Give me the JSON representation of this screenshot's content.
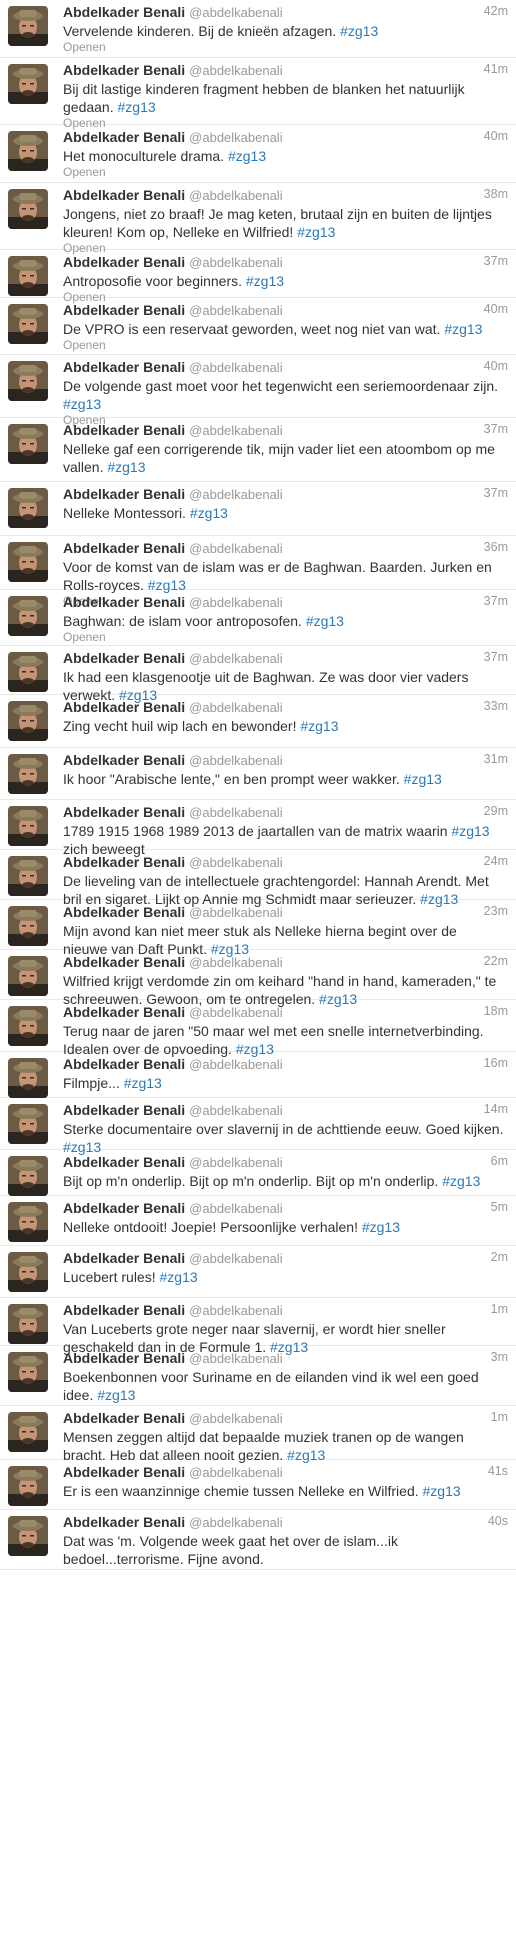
{
  "user": {
    "name": "Abdelkader Benali",
    "handle": "@abdelkabenali"
  },
  "expand_label": "Openen",
  "tweets": [
    {
      "time": "42m",
      "text": "Vervelende kinderen. Bij de knieën afzagen.",
      "tag": "#zg13",
      "open": true
    },
    {
      "time": "41m",
      "text": "Bij dit lastige kinderen fragment hebben de blanken het natuurlijk gedaan.",
      "tag": "#zg13",
      "open": true
    },
    {
      "time": "40m",
      "text": "Het monoculturele drama.",
      "tag": "#zg13",
      "open": true
    },
    {
      "time": "38m",
      "text": "Jongens, niet zo braaf! Je mag keten, brutaal zijn en buiten de lijntjes kleuren! Kom op, Nelleke en Wilfried!",
      "tag": "#zg13",
      "open": true
    },
    {
      "time": "37m",
      "text": "Antroposofie voor beginners.",
      "tag": "#zg13",
      "open": true
    },
    {
      "time": "40m",
      "text": "De VPRO is een reservaat geworden, weet nog niet van wat.",
      "tag": "#zg13",
      "open": true
    },
    {
      "time": "40m",
      "text": "De volgende gast moet voor het tegenwicht een seriemoordenaar zijn.",
      "tag": "#zg13",
      "open": true
    },
    {
      "time": "37m",
      "text": "Nelleke gaf een corrigerende tik, mijn vader liet een atoombom op me vallen.",
      "tag": "#zg13",
      "open": false
    },
    {
      "time": "37m",
      "text": "Nelleke Montessori.",
      "tag": "#zg13",
      "open": false
    },
    {
      "time": "36m",
      "text": "Voor de komst van de islam was er de Baghwan. Baarden. Jurken en Rolls-royces.",
      "tag": "#zg13",
      "open": true
    },
    {
      "time": "37m",
      "text": "Baghwan: de islam voor antroposofen.",
      "tag": "#zg13",
      "open": true
    },
    {
      "time": "37m",
      "text": "Ik had een klasgenootje uit de Baghwan. Ze was door vier vaders verwekt.",
      "tag": "#zg13",
      "open": false
    },
    {
      "time": "33m",
      "text": "Zing vecht huil wip lach en bewonder!",
      "tag": "#zg13",
      "open": false
    },
    {
      "time": "31m",
      "text": "Ik hoor \"Arabische lente,\" en ben prompt weer wakker.",
      "tag": "#zg13",
      "open": false
    },
    {
      "time": "29m",
      "text": "1789 1915 1968 1989 2013 de jaartallen van de matrix waarin",
      "tag": "#zg13",
      "tail": " zich beweegt",
      "open": false
    },
    {
      "time": "24m",
      "text": "De lieveling van de intellectuele grachtengordel: Hannah Arendt. Met bril en sigaret. Lijkt op Annie mg Schmidt maar serieuzer.",
      "tag": "#zg13",
      "open": false
    },
    {
      "time": "23m",
      "text": "Mijn avond kan niet meer stuk als Nelleke hierna begint over de nieuwe van Daft Punkt.",
      "tag": "#zg13",
      "open": false
    },
    {
      "time": "22m",
      "text": "Wilfried krijgt verdomde zin om keihard \"hand in hand, kameraden,\" te schreeuwen. Gewoon, om te ontregelen.",
      "tag": "#zg13",
      "open": false
    },
    {
      "time": "18m",
      "text": "Terug naar de jaren \"50 maar wel met een snelle internetverbinding. Idealen over de opvoeding.",
      "tag": "#zg13",
      "open": false
    },
    {
      "time": "16m",
      "text": "Filmpje...",
      "tag": "#zg13",
      "open": false
    },
    {
      "time": "14m",
      "text": "Sterke documentaire over slavernij in de achttiende eeuw. Goed kijken.",
      "tag": "#zg13",
      "open": false
    },
    {
      "time": "6m",
      "text": "Bijt op m'n onderlip. Bijt op m'n onderlip. Bijt op m'n onderlip.",
      "tag": "#zg13",
      "open": false
    },
    {
      "time": "5m",
      "text": "Nelleke ontdooit! Joepie! Persoonlijke verhalen!",
      "tag": "#zg13",
      "open": false
    },
    {
      "time": "2m",
      "text": "Lucebert rules!",
      "tag": "#zg13",
      "open": false
    },
    {
      "time": "1m",
      "text": "Van Luceberts grote neger naar slavernij, er wordt hier sneller geschakeld dan in de Formule 1.",
      "tag": "#zg13",
      "open": false
    },
    {
      "time": "3m",
      "text": "Boekenbonnen voor Suriname en de eilanden vind ik wel een goed idee.",
      "tag": "#zg13",
      "open": false
    },
    {
      "time": "1m",
      "text": "Mensen zeggen altijd dat bepaalde muziek tranen op de wangen bracht. Heb dat alleen nooit gezien.",
      "tag": "#zg13",
      "open": false
    },
    {
      "time": "41s",
      "text": "Er is een waanzinnige chemie tussen Nelleke en Wilfried.",
      "tag": "#zg13",
      "open": false
    },
    {
      "time": "40s",
      "text": "Dat was 'm. Volgende week gaat het over de islam...ik bedoel...terrorisme. Fijne avond.",
      "tag": "",
      "open": false
    }
  ]
}
